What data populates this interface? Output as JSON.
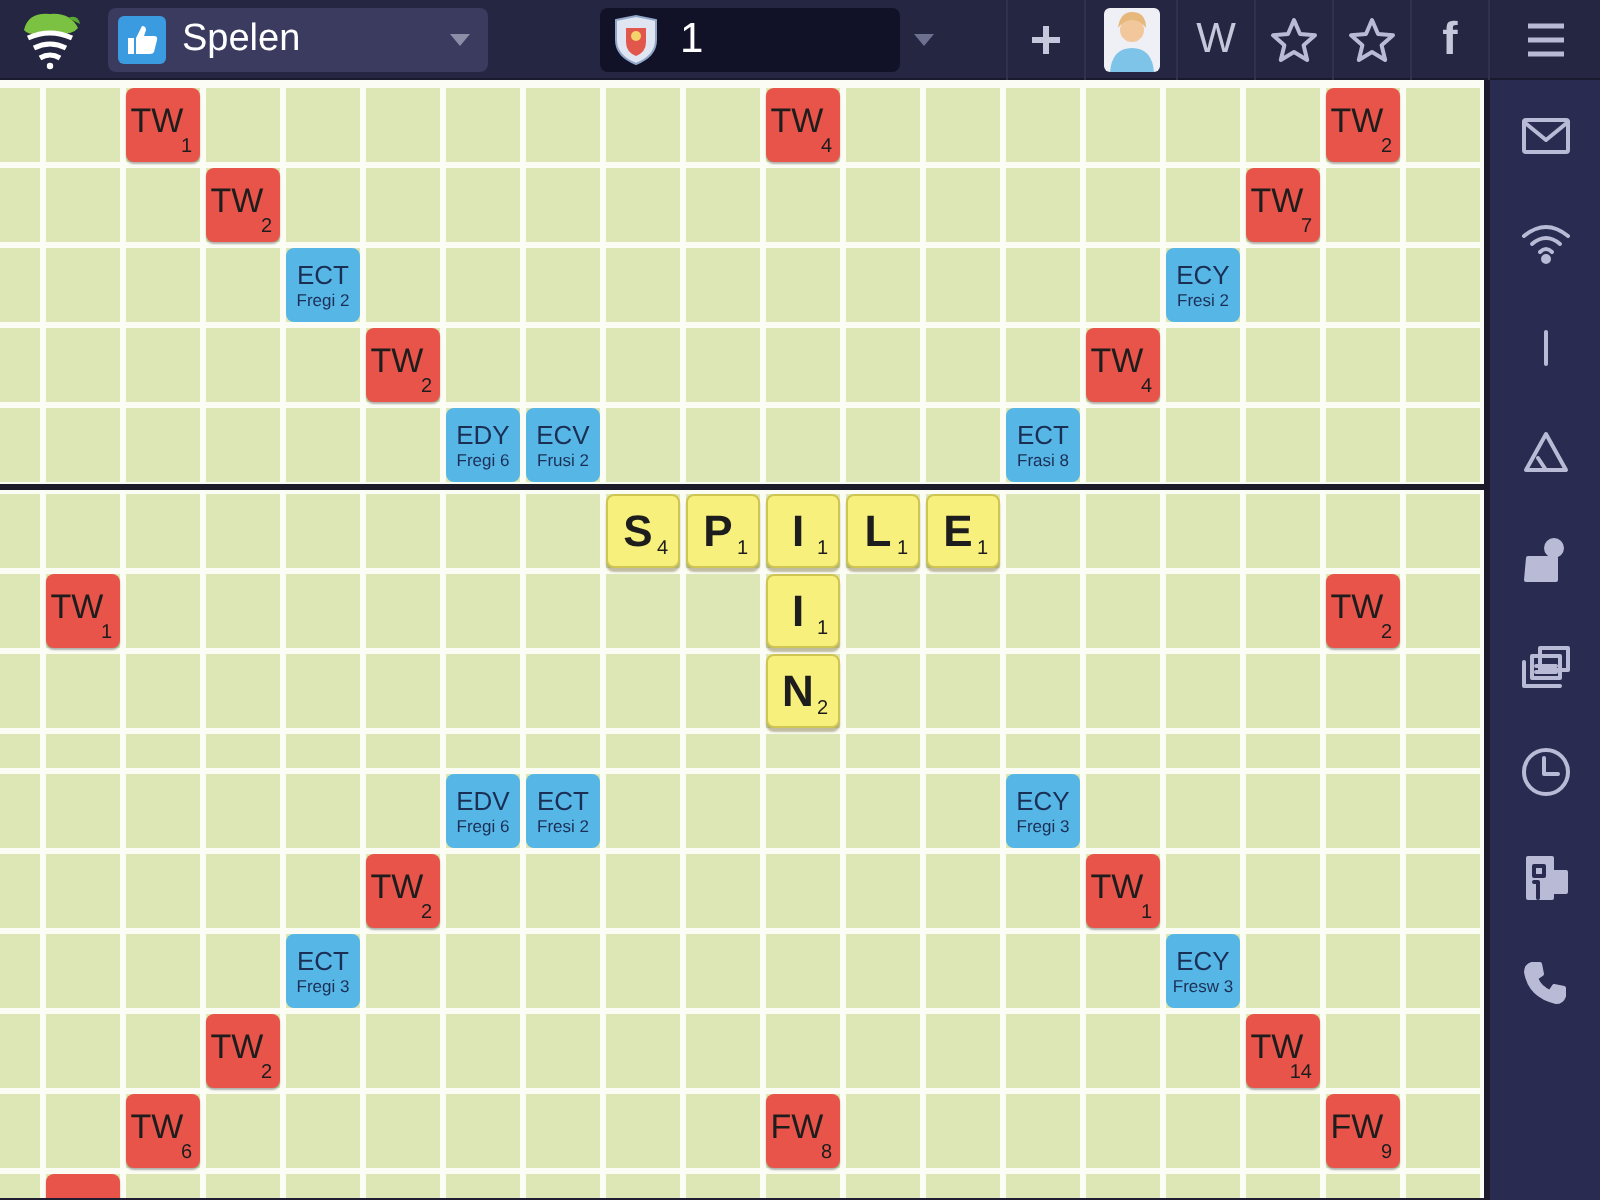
{
  "topbar": {
    "app_menu": {
      "label": "Spelen"
    },
    "game_field": {
      "value": "1"
    },
    "word_label": "W",
    "facebook_label": "f"
  },
  "board": {
    "top_rows": [
      [
        null,
        null,
        {
          "kind": "word",
          "text": "TW",
          "score": "1"
        },
        null,
        null,
        null,
        null,
        null,
        null,
        null,
        {
          "kind": "word",
          "text": "TW",
          "score": "4"
        },
        null,
        null,
        null,
        null,
        null,
        null,
        {
          "kind": "word",
          "text": "TW",
          "score": "2"
        },
        null
      ],
      [
        null,
        null,
        null,
        {
          "kind": "word",
          "text": "TW",
          "score": "2"
        },
        null,
        null,
        null,
        null,
        null,
        null,
        null,
        null,
        null,
        null,
        null,
        null,
        {
          "kind": "word",
          "text": "TW",
          "score": "7"
        },
        null,
        null
      ],
      [
        null,
        null,
        null,
        null,
        {
          "kind": "letter",
          "text": "ECT",
          "subtext": "Fregi 2"
        },
        null,
        null,
        null,
        null,
        null,
        null,
        null,
        null,
        null,
        null,
        {
          "kind": "letter",
          "text": "ECY",
          "subtext": "Fresi 2"
        },
        null,
        null,
        null
      ],
      [
        null,
        null,
        null,
        null,
        null,
        {
          "kind": "word",
          "text": "TW",
          "score": "2"
        },
        null,
        null,
        null,
        null,
        null,
        null,
        null,
        null,
        {
          "kind": "word",
          "text": "TW",
          "score": "4"
        },
        null,
        null,
        null,
        null
      ],
      [
        null,
        null,
        null,
        null,
        null,
        null,
        {
          "kind": "letter",
          "text": "EDY",
          "subtext": "Fregi 6"
        },
        {
          "kind": "letter",
          "text": "ECV",
          "subtext": "Frusi 2"
        },
        null,
        null,
        null,
        null,
        null,
        {
          "kind": "letter",
          "text": "ECT",
          "subtext": "Frasi 8"
        },
        null,
        null,
        null,
        null,
        null
      ]
    ],
    "bottom_rows": [
      [
        null,
        null,
        null,
        null,
        null,
        null,
        null,
        null,
        {
          "kind": "tile",
          "text": "S",
          "score": "4"
        },
        {
          "kind": "tile",
          "text": "P",
          "score": "1"
        },
        {
          "kind": "tile",
          "text": "I",
          "score": "1"
        },
        {
          "kind": "tile",
          "text": "L",
          "score": "1"
        },
        {
          "kind": "tile",
          "text": "E",
          "score": "1"
        },
        null,
        null,
        null,
        null,
        null,
        null
      ],
      [
        null,
        {
          "kind": "word",
          "text": "TW",
          "score": "1"
        },
        null,
        null,
        null,
        null,
        null,
        null,
        null,
        null,
        {
          "kind": "tile",
          "text": "I",
          "score": "1"
        },
        null,
        null,
        null,
        null,
        null,
        null,
        {
          "kind": "word",
          "text": "TW",
          "score": "2"
        },
        null
      ],
      [
        null,
        null,
        null,
        null,
        null,
        null,
        null,
        null,
        null,
        null,
        {
          "kind": "tile",
          "text": "N",
          "score": "2"
        },
        null,
        null,
        null,
        null,
        null,
        null,
        null,
        null
      ],
      [
        null,
        null,
        null,
        null,
        null,
        null,
        {
          "kind": "letter",
          "text": "EDV",
          "subtext": "Fregi 6"
        },
        {
          "kind": "letter",
          "text": "ECT",
          "subtext": "Fresi 2"
        },
        null,
        null,
        null,
        null,
        null,
        {
          "kind": "letter",
          "text": "ECY",
          "subtext": "Fregi 3"
        },
        null,
        null,
        null,
        null,
        null
      ],
      [
        null,
        null,
        null,
        null,
        null,
        {
          "kind": "word",
          "text": "TW",
          "score": "2"
        },
        null,
        null,
        null,
        null,
        null,
        null,
        null,
        null,
        {
          "kind": "word",
          "text": "TW",
          "score": "1"
        },
        null,
        null,
        null,
        null
      ],
      [
        null,
        null,
        null,
        null,
        {
          "kind": "letter",
          "text": "ECT",
          "subtext": "Fregi 3"
        },
        null,
        null,
        null,
        null,
        null,
        null,
        null,
        null,
        null,
        null,
        {
          "kind": "letter",
          "text": "ECY",
          "subtext": "Fresw 3"
        },
        null,
        null,
        null
      ],
      [
        null,
        null,
        null,
        {
          "kind": "word",
          "text": "TW",
          "score": "2"
        },
        null,
        null,
        null,
        null,
        null,
        null,
        null,
        null,
        null,
        null,
        null,
        null,
        {
          "kind": "word",
          "text": "TW",
          "score": "14"
        },
        null,
        null
      ],
      [
        null,
        null,
        {
          "kind": "word",
          "text": "TW",
          "score": "6"
        },
        null,
        null,
        null,
        null,
        null,
        null,
        null,
        {
          "kind": "word",
          "text": "FW",
          "score": "8"
        },
        null,
        null,
        null,
        null,
        null,
        null,
        {
          "kind": "word",
          "text": "FW",
          "score": "9"
        },
        null
      ],
      [
        null,
        {
          "kind": "word"
        },
        null,
        null,
        null,
        null,
        null,
        null,
        null,
        null,
        null,
        null,
        null,
        null,
        null,
        null,
        null,
        null,
        null
      ]
    ]
  }
}
